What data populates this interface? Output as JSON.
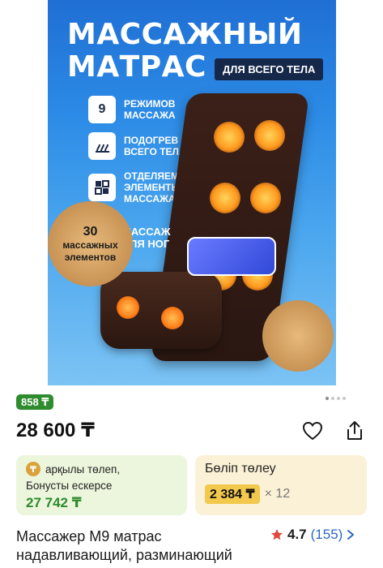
{
  "product_image": {
    "headline_line1": "МАССАЖНЫЙ",
    "headline_line2": "МАТРАС",
    "tag": "ДЛЯ ВСЕГО ТЕЛА",
    "features": [
      {
        "icon_text": "9",
        "label": "РЕЖИМОВ МАССАЖА"
      },
      {
        "icon_text": "",
        "label": "ПОДОГРЕВ ВСЕГО ТЕЛА"
      },
      {
        "icon_text": "",
        "label": "ОТДЕЛЯЕМЫЕ ЭЛЕМЕНТЫ МАССАЖА"
      }
    ],
    "elements_count": "30",
    "elements_label": "массажных элементов",
    "foot_label": "МАССАЖ ДЛЯ НОГ",
    "gallery_dots": 4,
    "gallery_active_index": 0
  },
  "badge": {
    "text": "858 ₸"
  },
  "price": {
    "text": "28 600 ₸"
  },
  "actions": {
    "favorite_icon": "heart-icon",
    "share_icon": "share-icon"
  },
  "bonus_card": {
    "pay_text": "арқылы төлеп,",
    "bonus_text": "Бонусты ескерсе",
    "bonus_price": "27 742 ₸"
  },
  "installment_card": {
    "title": "Бөліп төлеу",
    "amount": "2 384 ₸",
    "multiplier": "× 12"
  },
  "product": {
    "title": "Массажер М9 матрас надавливающий, разминающий",
    "rating": "4.7",
    "reviews": "(155)"
  },
  "colors": {
    "badge_green": "#2e8b2e",
    "link_blue": "#2c66c4",
    "star_red": "#e0483c",
    "installment_yellow": "#f2c94c"
  }
}
